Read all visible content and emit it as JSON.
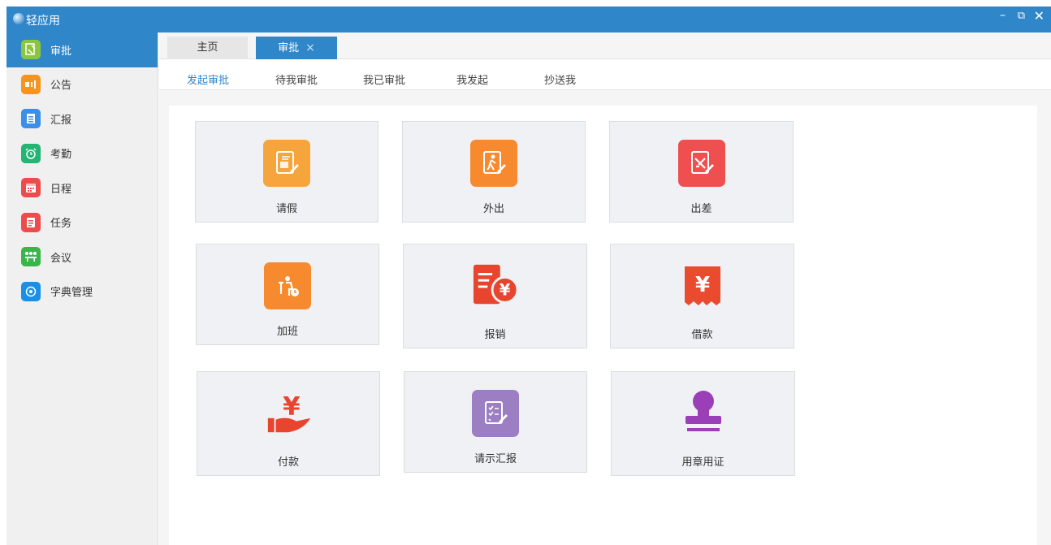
{
  "app": {
    "title": "轻应用"
  },
  "window_controls": {
    "minimize": "–",
    "restore": "⧉",
    "close": "✕"
  },
  "sidebar": {
    "items": [
      {
        "label": "审批",
        "icon": "approval-icon",
        "color": "#8cc63f",
        "active": true
      },
      {
        "label": "公告",
        "icon": "megaphone-icon",
        "color": "#f7931e"
      },
      {
        "label": "汇报",
        "icon": "report-icon",
        "color": "#3b8fe8"
      },
      {
        "label": "考勤",
        "icon": "alarm-clock-icon",
        "color": "#22b573"
      },
      {
        "label": "日程",
        "icon": "calendar-icon",
        "color": "#ed4c4c"
      },
      {
        "label": "任务",
        "icon": "task-icon",
        "color": "#ed4c4c"
      },
      {
        "label": "会议",
        "icon": "meeting-icon",
        "color": "#39b54a"
      },
      {
        "label": "字典管理",
        "icon": "dictionary-icon",
        "color": "#1a8fe8"
      }
    ]
  },
  "tabs": {
    "home": "主页",
    "approve": "审批",
    "close_icon": "×"
  },
  "subtabs": [
    "发起审批",
    "待我审批",
    "我已审批",
    "我发起",
    "抄送我"
  ],
  "cards": [
    {
      "label": "请假",
      "icon": "leave-icon",
      "color": "#f6a53c"
    },
    {
      "label": "外出",
      "icon": "going-out-icon",
      "color": "#f7892e"
    },
    {
      "label": "出差",
      "icon": "business-trip-icon",
      "color": "#ef4f4f"
    },
    {
      "label": "加班",
      "icon": "overtime-icon",
      "color": "#f7892e"
    },
    {
      "label": "报销",
      "icon": "reimbursement-icon",
      "color": "#e8452f"
    },
    {
      "label": "借款",
      "icon": "loan-icon",
      "color": "#ea4a2e"
    },
    {
      "label": "付款",
      "icon": "payment-icon",
      "color": "#e8452f"
    },
    {
      "label": "请示汇报",
      "icon": "request-report-icon",
      "color": "#9b7fc2"
    },
    {
      "label": "用章用证",
      "icon": "seal-icon",
      "color": "#9a3fb8"
    }
  ]
}
